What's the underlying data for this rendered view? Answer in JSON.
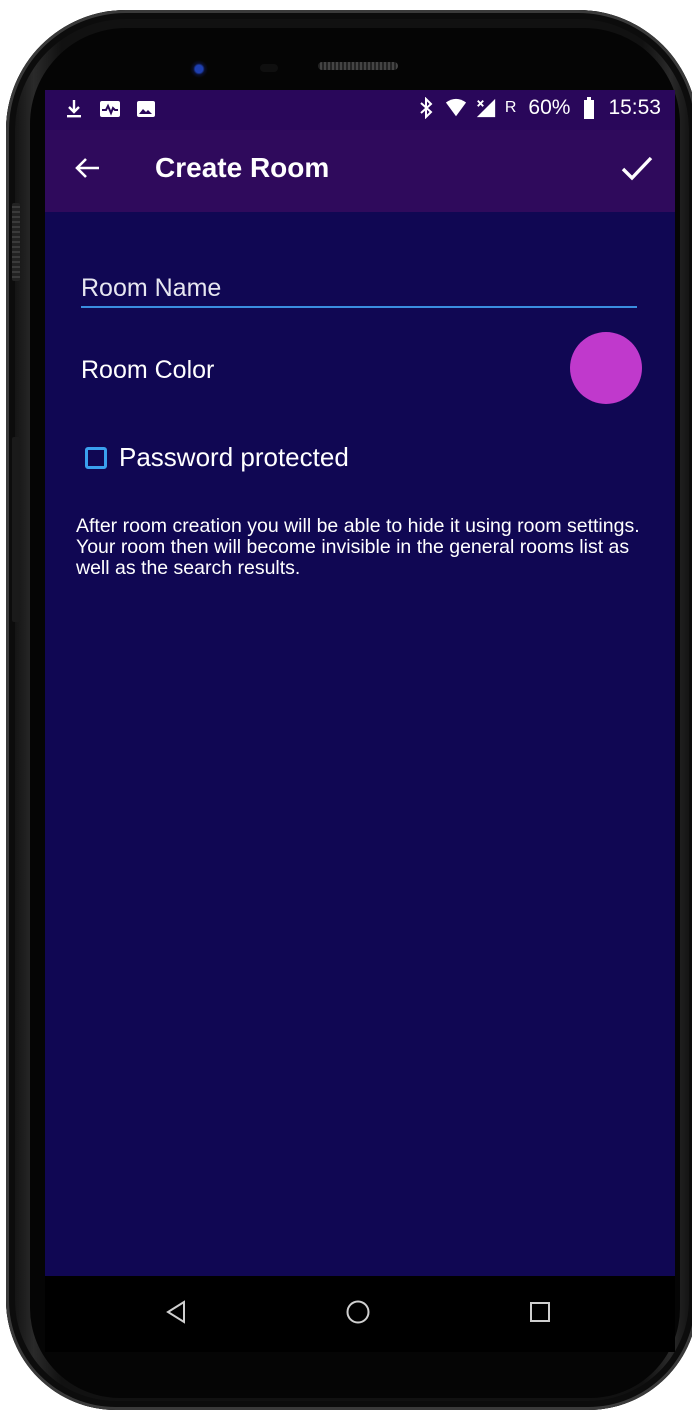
{
  "status_bar": {
    "left_icons": [
      "download-icon",
      "activity-icon",
      "image-icon"
    ],
    "right_icons": [
      "bluetooth-icon",
      "wifi-icon",
      "signal-icon"
    ],
    "roaming": "R",
    "battery": "60%",
    "time": "15:53"
  },
  "app_bar": {
    "title": "Create Room",
    "back_icon": "arrow-left-icon",
    "confirm_icon": "checkmark-icon"
  },
  "form": {
    "room_name_placeholder": "Room Name",
    "room_name_value": "",
    "room_color_label": "Room Color",
    "room_color": "#c039cc",
    "password_label": "Password protected",
    "password_checked": false,
    "info_text": "After room creation you will be able to hide it using room settings. Your room then will become invisible in the general rooms list as well as the search results."
  },
  "nav_bar": {
    "buttons": [
      "back-triangle-icon",
      "home-circle-icon",
      "recent-square-icon"
    ]
  },
  "colors": {
    "screen_bg": "#100753",
    "app_bar_bg": "#2f0a5c",
    "status_bar_bg": "#29075a",
    "accent": "#3a8de0"
  }
}
